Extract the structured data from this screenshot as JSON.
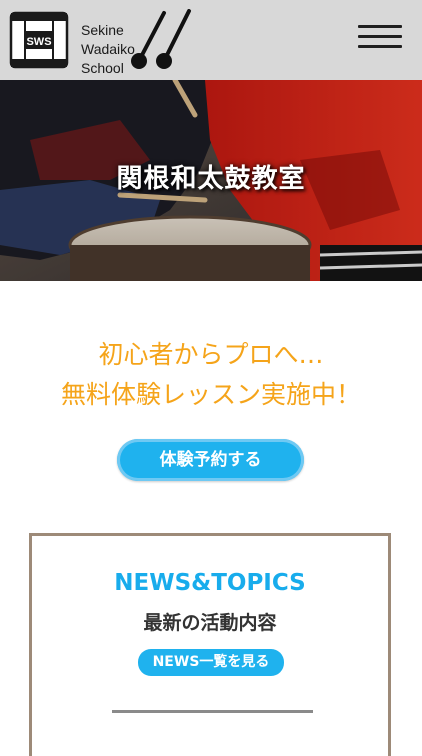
{
  "header": {
    "logo_badge": "SWS",
    "logo_lines": [
      "Sekine",
      "Wadaiko",
      "School"
    ],
    "menu_icon": "hamburger-menu-icon"
  },
  "hero": {
    "title": "関根和太鼓教室"
  },
  "lead": {
    "line1": "初心者からプロへ…",
    "line2": "無料体験レッスン実施中！",
    "cta_label": "体験予約する"
  },
  "news": {
    "title": "NEWS&TOPICS",
    "subtitle": "最新の活動内容",
    "button_label": "NEWS一覧を見る"
  },
  "colors": {
    "accent_blue": "#1fb2ee",
    "lead_orange": "#f5a41a",
    "header_gray": "#d8d8d8",
    "news_border": "#9d8a78"
  }
}
